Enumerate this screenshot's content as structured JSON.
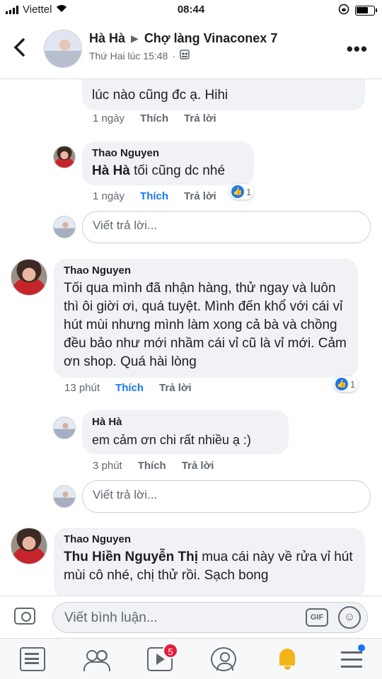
{
  "status_bar": {
    "carrier": "Viettel",
    "time": "08:44"
  },
  "header": {
    "author": "Hà Hà",
    "group": "Chợ làng Vinaconex 7",
    "timestamp": "Thứ Hai lúc 15:48",
    "separator": "·"
  },
  "comments": [
    {
      "text": "lúc nào cũng đc ạ. Hihi",
      "time": "1 ngày",
      "like_label": "Thích",
      "reply_label": "Trả lời"
    },
    {
      "name": "Thao Nguyen",
      "mention": "Hà Hà",
      "text": " tối cũng dc nhé",
      "time": "1 ngày",
      "like_label": "Thích",
      "liked": true,
      "reply_label": "Trả lời",
      "reactions": "1"
    },
    {
      "name": "Thao Nguyen",
      "text": "Tối qua mình đã nhận hàng, thử ngay và luôn thì ôi giời ơi, quá tuyệt. Mình đến khổ với cái vỉ hút mùi nhưng mình làm  xong cả bà và chồng đều bảo như mới nhầm cái vỉ cũ là vỉ mới. Cảm ơn shop. Quá hài lòng",
      "time": "13 phút",
      "like_label": "Thích",
      "liked": true,
      "reply_label": "Trả lời",
      "reactions": "1"
    },
    {
      "name": "Hà Hà",
      "text": "em cảm ơn chi rất nhiều ạ :)",
      "time": "3 phút",
      "like_label": "Thích",
      "reply_label": "Trả lời"
    },
    {
      "name": "Thao Nguyen",
      "mention": "Thu Hiền Nguyễn Thị",
      "text": " mua cái này về rửa vỉ hút mùi cô nhé, chị thử rồi. Sạch bong"
    }
  ],
  "reply_placeholder": "Viết trả lời...",
  "composer": {
    "placeholder": "Viết bình luận...",
    "gif_label": "GIF"
  },
  "tab_bar": {
    "video_badge": "5"
  },
  "colors": {
    "accent": "#1877f2",
    "bubble": "#f0f2f5",
    "badge": "#e41e3f",
    "bell": "#f5b418"
  }
}
